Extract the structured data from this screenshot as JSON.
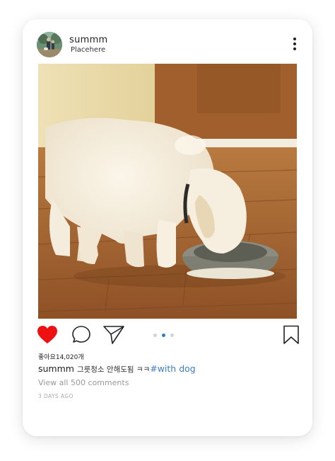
{
  "post": {
    "username": "summm",
    "location": "Placehere",
    "image_alt": "puppy eating from bowl",
    "likes_text": "좋아요14,020개",
    "caption_user": "summm",
    "caption_text": "그릇청소 안해도됨 ㅋㅋ",
    "caption_hashtag": "#with dog",
    "comments_link": "View all 500 comments",
    "time_ago": "3 DAYS AGO"
  },
  "carousel": {
    "count": 3,
    "active_index": 1
  },
  "icons": {
    "more": "more-vertical-icon",
    "like": "heart-icon",
    "comment": "comment-icon",
    "share": "send-icon",
    "save": "bookmark-icon"
  },
  "colors": {
    "like_active": "#ee1111",
    "hashtag": "#3b7fc4",
    "carousel_active": "#2f7ec4",
    "carousel_inactive": "#cfd4d8"
  }
}
